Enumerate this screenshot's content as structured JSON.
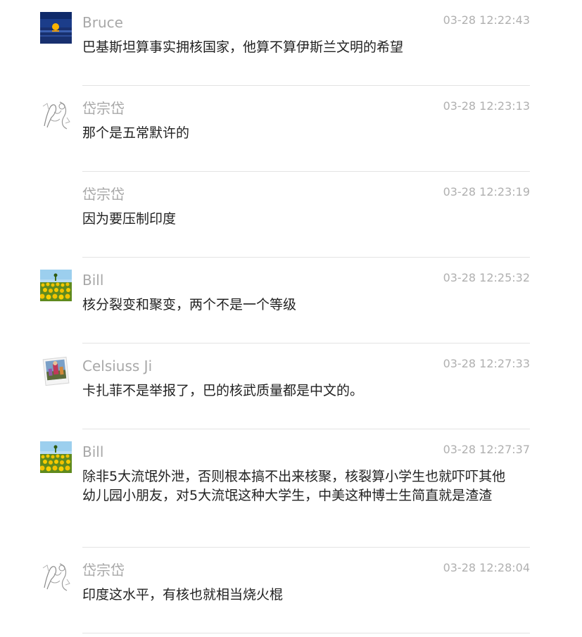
{
  "messages": [
    {
      "sender": "Bruce",
      "time": "03-28 12:22:43",
      "text": "巴基斯坦算事实拥核国家，他算不算伊斯兰文明的希望",
      "avatar": "sunset-avatar"
    },
    {
      "sender": "岱宗岱",
      "time": "03-28 12:23:13",
      "text": "那个是五常默许的",
      "avatar": "sketch-avatar"
    },
    {
      "sender": "岱宗岱",
      "time": "03-28 12:23:19",
      "text": "因为要压制印度",
      "avatar": ""
    },
    {
      "sender": "Bill",
      "time": "03-28 12:25:32",
      "text": "核分裂变和聚变，两个不是一个等级",
      "avatar": "sunflower-avatar"
    },
    {
      "sender": "Celsiuss Ji",
      "time": "03-28 12:27:33",
      "text": "卡扎菲不是举报了，巴的核武质量都是中文的。",
      "avatar": "photo-avatar"
    },
    {
      "sender": "Bill",
      "time": "03-28 12:27:37",
      "text": "除非5大流氓外泄，否则根本搞不出来核聚，核裂算小学生也就吓吓其他幼儿园小朋友，对5大流氓这种大学生，中美这种博士生简直就是渣渣",
      "avatar": "sunflower-avatar"
    },
    {
      "sender": "岱宗岱",
      "time": "03-28 12:28:04",
      "text": "印度这水平，有核也就相当烧火棍",
      "avatar": "sketch-avatar"
    }
  ]
}
